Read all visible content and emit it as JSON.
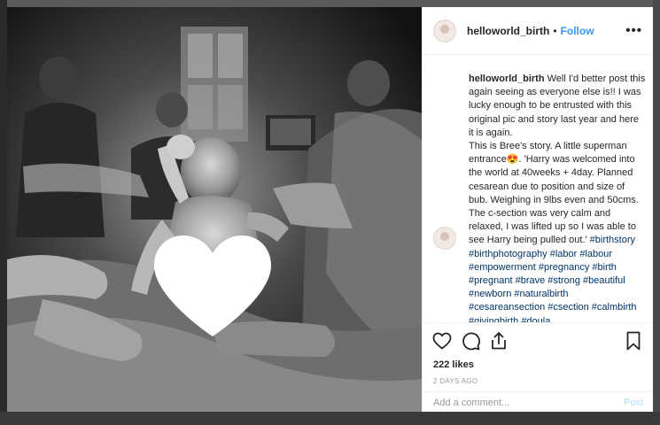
{
  "header": {
    "username": "helloworld_birth",
    "separator": "•",
    "follow_label": "Follow",
    "more_label": "•••"
  },
  "caption": {
    "username": "helloworld_birth",
    "text": "Well I'd better post this again seeing as everyone else is!! I was lucky enough to be entrusted with this original pic and story last year and here it is again.\nThis is Bree's story. A little superman entrance😍. 'Harry was welcomed into the world at 40weeks + 4day.  Planned cesarean due to position and size of bub.  Weighing in 9lbs even and 50cms.  The c-section was very calm and relaxed, I was lifted up so I was able to see Harry being pulled out.'",
    "hashtags": "#birthstory #birthphotography #labor #labour #empowerment #pregnancy #birth #pregnant #brave #strong #beautiful #newborn #naturalbirth #cesareansection #csection #calmbirth #givingbirth #doula"
  },
  "post": {
    "likes": "222 likes",
    "timestamp": "2 DAYS AGO"
  },
  "comment_box": {
    "placeholder": "Add a comment...",
    "post_label": "Post"
  },
  "icons": {
    "like": "heart-outline-icon",
    "comment": "comment-bubble-icon",
    "share": "share-upload-icon",
    "save": "bookmark-icon",
    "more": "more-options-icon",
    "censor": "white-heart-overlay"
  },
  "colors": {
    "link": "#3897f0",
    "hashtag": "#003569",
    "post_disabled": "#b2dffc",
    "text": "#262626",
    "muted": "#999999"
  }
}
